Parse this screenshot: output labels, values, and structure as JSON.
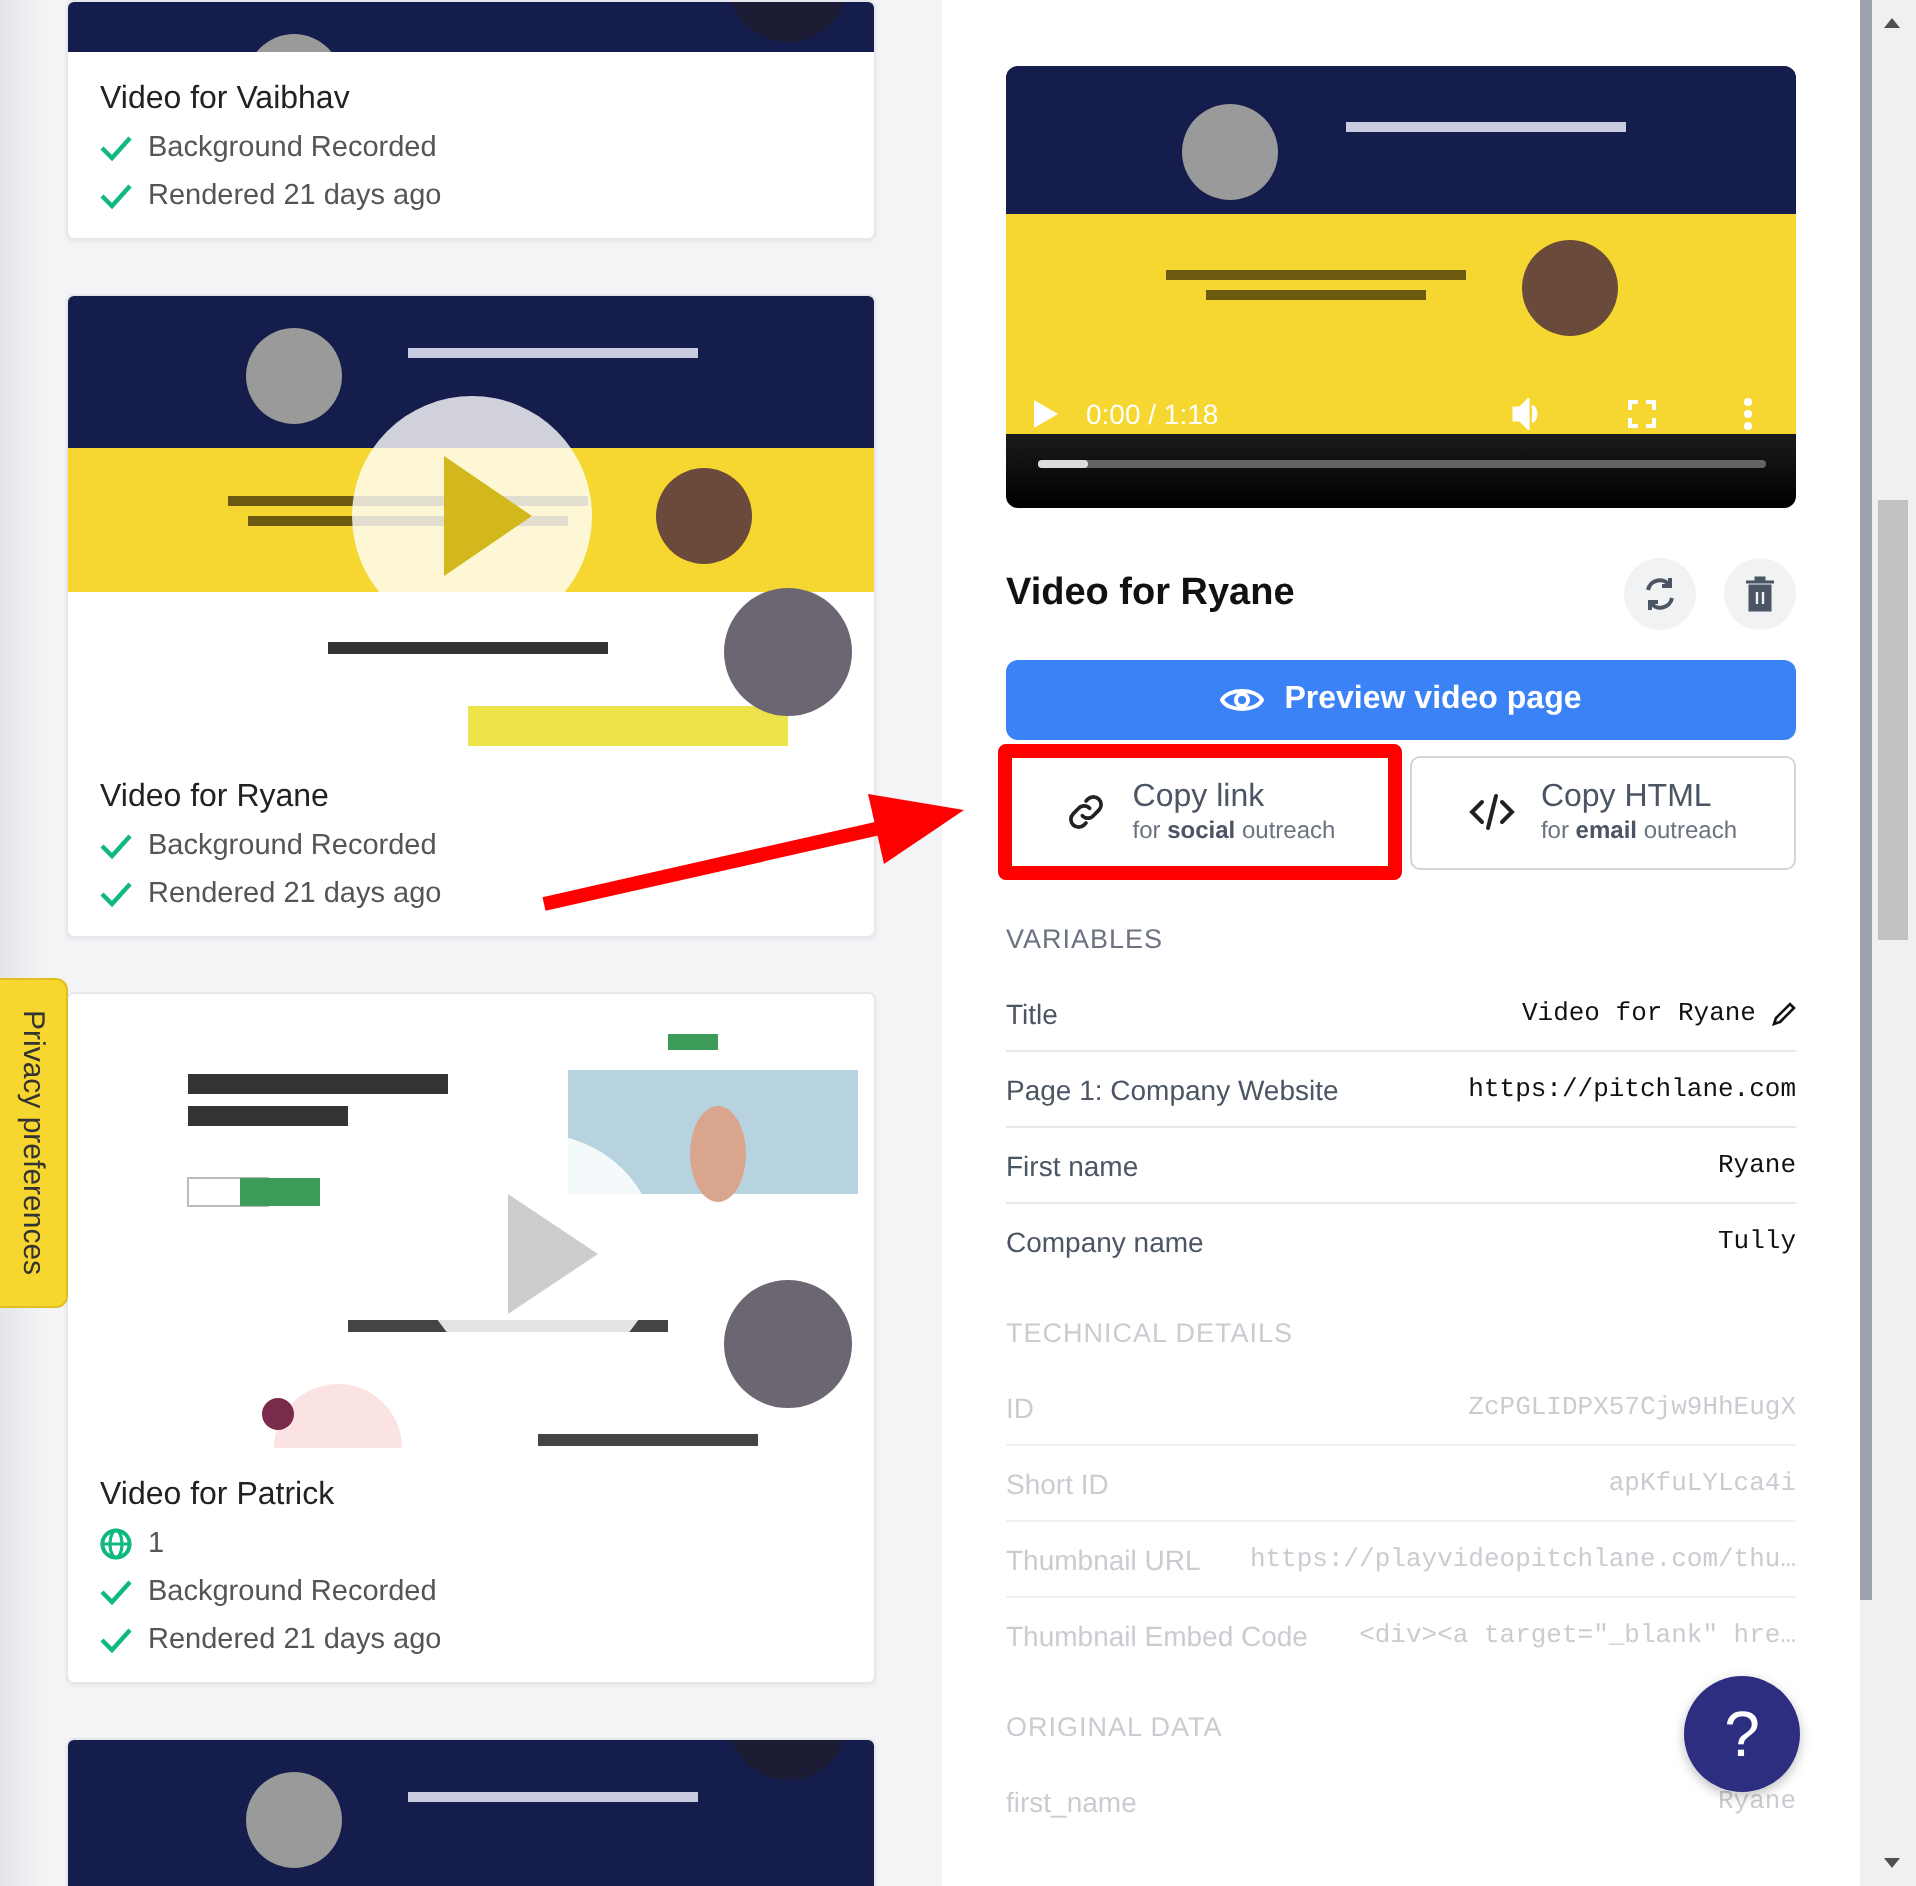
{
  "privacy_tab": {
    "label": "Privacy preferences"
  },
  "video_cards": [
    {
      "kind": "video",
      "title": "Video for Vaibhav",
      "statuses": [
        {
          "text": "Background Recorded",
          "done": true
        },
        {
          "text": "Rendered 21 days ago",
          "done": true
        }
      ]
    },
    {
      "kind": "video",
      "title": "Video for Ryane",
      "statuses": [
        {
          "text": "Background Recorded",
          "done": true
        },
        {
          "text": "Rendered 21 days ago",
          "done": true
        }
      ]
    },
    {
      "kind": "video",
      "title": "Video for Patrick",
      "stats": [
        {
          "kind": "views",
          "text": "1"
        }
      ],
      "statuses": [
        {
          "text": "Background Recorded",
          "done": true
        },
        {
          "text": "Rendered 21 days ago",
          "done": true
        }
      ]
    },
    {
      "kind": "picture"
    }
  ],
  "detail": {
    "player": {
      "time": "0:00 / 1:18",
      "level": 0.07
    },
    "title": "Video for Ryane",
    "preview_button": "Preview video page",
    "copy_buttons": [
      {
        "kind": "link",
        "label": "Copy link",
        "sub": "for **social** outreach",
        "highlighted": true
      },
      {
        "kind": "html",
        "label": "Copy HTML",
        "sub": "for **email** outreach",
        "highlighted": false
      }
    ],
    "sections": [
      {
        "heading": "VARIABLES",
        "disabled": false,
        "rows": [
          {
            "label": "Title",
            "value": "Video for Ryane",
            "editable": true
          },
          {
            "label": "Page 1: Company Website",
            "value": "https://pitchlane.com"
          },
          {
            "label": "First name",
            "value": "Ryane"
          },
          {
            "label": "Company name",
            "value": "Tully"
          }
        ]
      },
      {
        "heading": "TECHNICAL DETAILS",
        "disabled": true,
        "rows": [
          {
            "label": "ID",
            "value": "ZcPGLIDPX57Cjw9HhEugX"
          },
          {
            "label": "Short ID",
            "value": "apKfuLYLca4i"
          },
          {
            "label": "Thumbnail URL",
            "value": "https://playvideopitchlane.com/thu…"
          },
          {
            "label": "Thumbnail Embed Code",
            "value": "<div><a target=\"_blank\" hre…"
          }
        ]
      },
      {
        "heading": "ORIGINAL DATA",
        "disabled": true,
        "rows": [
          {
            "label": "first_name",
            "value": "Ryane"
          }
        ]
      }
    ]
  },
  "help_button": {
    "label": "?"
  }
}
